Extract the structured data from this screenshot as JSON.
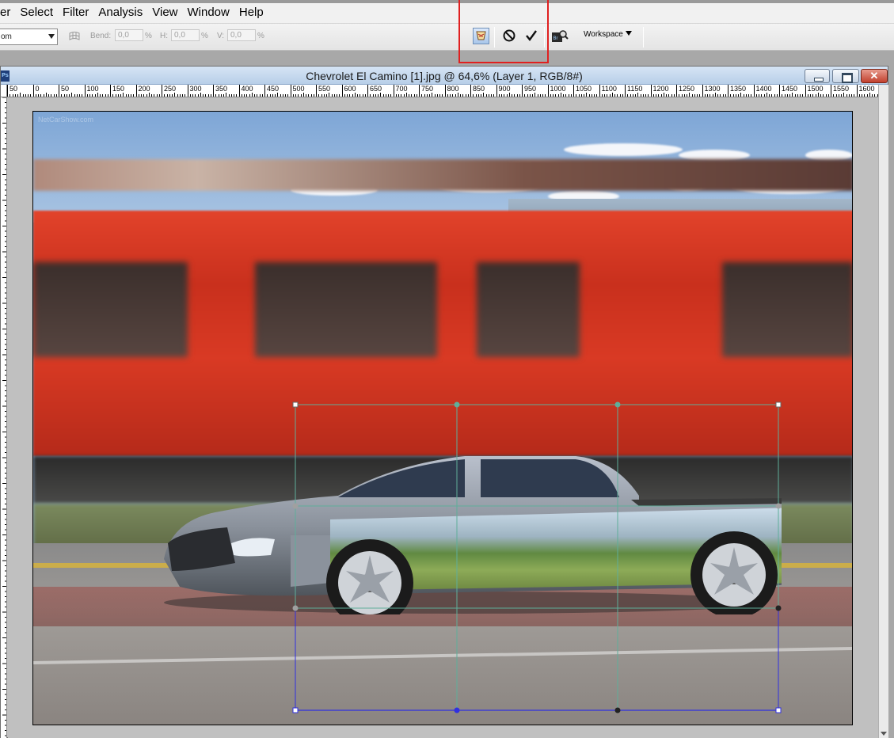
{
  "menu": {
    "items": [
      "er",
      "Select",
      "Filter",
      "Analysis",
      "View",
      "Window",
      "Help"
    ]
  },
  "options": {
    "mode_value": "om",
    "bend_label": "Bend:",
    "bend_value": "0,0",
    "h_label": "H:",
    "h_value": "0,0",
    "v_label": "V:",
    "v_value": "0,0",
    "pct": "%",
    "workspace_label": "Workspace"
  },
  "document": {
    "title": "Chevrolet El Camino [1].jpg @ 64,6% (Layer 1, RGB/8#)",
    "app_badge": "Ps",
    "watermark": "NetCarShow.com"
  },
  "ruler": {
    "labels": [
      "50",
      "0",
      "50",
      "100",
      "150",
      "200",
      "250",
      "300",
      "350",
      "400",
      "450",
      "500",
      "550",
      "600",
      "650",
      "700",
      "750",
      "800",
      "850",
      "900",
      "950",
      "1000",
      "1050",
      "1100",
      "1150",
      "1200",
      "1250",
      "1300",
      "1350",
      "1400",
      "1450",
      "1500",
      "1550",
      "1600"
    ]
  },
  "colors": {
    "highlight": "#e02020",
    "grid_line": "#5fae9a",
    "grid_handle_blue": "#3030e0"
  },
  "icons": {
    "warp": "warp-mesh-icon",
    "toggle": "warp-mode-toggle-icon",
    "cancel": "cancel-transform-icon",
    "commit": "commit-transform-icon",
    "bridge": "bridge-browse-icon"
  }
}
